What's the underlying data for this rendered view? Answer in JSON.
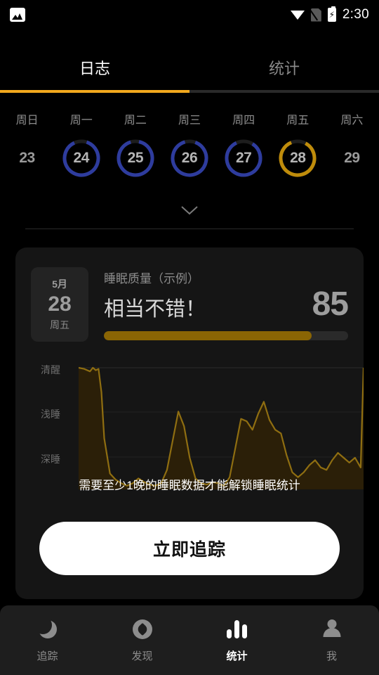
{
  "status_bar": {
    "left_icon": "photo-icon",
    "wifi_icon": "wifi-icon",
    "sim_icon": "sim-no-signal-icon",
    "battery_icon": "battery-charging-icon",
    "time": "2:30"
  },
  "tabs": {
    "items": [
      {
        "label": "日志",
        "active": true
      },
      {
        "label": "统计",
        "active": false
      }
    ],
    "indicator_color": "#F2A81D"
  },
  "week_strip": {
    "weekday_names": [
      "周日",
      "周一",
      "周二",
      "周三",
      "周四",
      "周五",
      "周六"
    ],
    "days": [
      {
        "num": "23",
        "ring": "none",
        "progress": 0
      },
      {
        "num": "24",
        "ring": "blue",
        "progress": 88
      },
      {
        "num": "25",
        "ring": "blue",
        "progress": 92
      },
      {
        "num": "26",
        "ring": "blue",
        "progress": 90
      },
      {
        "num": "27",
        "ring": "blue",
        "progress": 84
      },
      {
        "num": "28",
        "ring": "gold",
        "progress": 86
      },
      {
        "num": "29",
        "ring": "none",
        "progress": 0
      }
    ],
    "ring_blue": "#2E3C9E",
    "ring_gold": "#BF8C0B",
    "ring_track": "#1d1d1d",
    "expand_icon": "chevron-down-icon"
  },
  "card": {
    "date_block": {
      "month": "5月",
      "day": "28",
      "weekday": "周五"
    },
    "quality_title": "睡眠质量（示例）",
    "verdict": "相当不错！",
    "score": "85",
    "progress_percent": 85,
    "progress_fill_color": "#8A6504"
  },
  "chart_data": {
    "type": "area",
    "title": "睡眠质量（示例）",
    "xlabel": "",
    "ylabel": "",
    "ytick_labels": [
      "清醒",
      "浅睡",
      "深睡"
    ],
    "ylim": [
      0,
      100
    ],
    "grid": true,
    "line_color": "#8A6A10",
    "fill_color": "#30240a",
    "x": [
      0,
      2,
      4,
      5,
      6,
      7,
      8,
      9,
      11,
      13,
      15,
      17,
      19,
      21,
      23,
      25,
      27,
      29,
      31,
      33,
      35,
      37,
      39,
      41,
      43,
      45,
      47,
      49,
      51,
      53,
      55,
      57,
      59,
      61,
      63,
      65,
      67,
      69,
      71,
      73,
      75,
      77,
      79,
      81,
      83,
      85,
      87,
      89,
      91,
      93,
      95,
      97,
      99,
      100
    ],
    "values": [
      100,
      99,
      97,
      100,
      98,
      99,
      80,
      42,
      13,
      8,
      5,
      3,
      5,
      9,
      6,
      4,
      3,
      5,
      16,
      40,
      64,
      52,
      26,
      9,
      5,
      4,
      6,
      5,
      3,
      10,
      34,
      58,
      56,
      49,
      62,
      72,
      57,
      49,
      46,
      28,
      14,
      10,
      14,
      20,
      24,
      18,
      16,
      24,
      30,
      26,
      22,
      26,
      18,
      100
    ]
  },
  "overlay": {
    "message": "需要至少1晚的睡眠数据才能解锁睡眠统计",
    "cta_label": "立即追踪"
  },
  "bottom_nav": {
    "items": [
      {
        "label": "追踪",
        "icon": "moon-icon",
        "active": false
      },
      {
        "label": "发现",
        "icon": "compass-icon",
        "active": false
      },
      {
        "label": "统计",
        "icon": "bar-chart-icon",
        "active": true
      },
      {
        "label": "我",
        "icon": "person-icon",
        "active": false
      }
    ]
  }
}
